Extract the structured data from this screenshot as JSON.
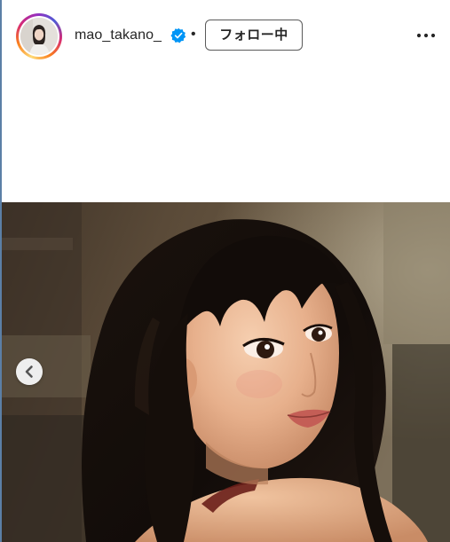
{
  "post": {
    "username": "mao_takano_",
    "separator": "•",
    "follow_label": "フォロー中",
    "verified": true
  },
  "icons": {
    "verified": "verified-badge-icon",
    "more": "more-horizontal-icon",
    "prev": "chevron-left-icon",
    "avatar": "profile-avatar"
  },
  "colors": {
    "verified_blue": "#0095f6",
    "text": "#262626",
    "button_border": "#5a5a5a",
    "story_ring": [
      "#feda75",
      "#fa7e1e",
      "#d62976",
      "#962fbf",
      "#4f5bd5"
    ]
  }
}
